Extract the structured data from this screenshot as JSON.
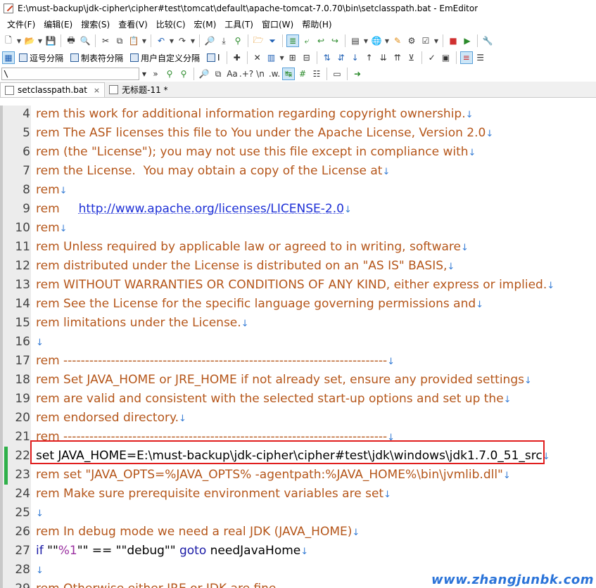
{
  "window": {
    "title": "E:\\must-backup\\jdk-cipher\\cipher#test\\tomcat\\default\\apache-tomcat-7.0.70\\bin\\setclasspath.bat - EmEditor"
  },
  "menu": [
    "文件(F)",
    "编辑(E)",
    "搜索(S)",
    "查看(V)",
    "比较(C)",
    "宏(M)",
    "工具(T)",
    "窗口(W)",
    "帮助(H)"
  ],
  "toolbar2": {
    "items": [
      "逗号分隔",
      "制表符分隔",
      "用户自定义分隔"
    ],
    "tail": "I"
  },
  "search": {
    "value": "\\",
    "regex_labels": [
      ".+?",
      "\\n",
      ".w."
    ]
  },
  "tabs": [
    {
      "label": "setclasspath.bat",
      "active": true,
      "close": "×"
    },
    {
      "label": "无标题-11 *",
      "active": false
    }
  ],
  "lines": [
    {
      "num": "4",
      "text": "rem this work for additional information regarding copyright ownership."
    },
    {
      "num": "5",
      "text": "rem The ASF licenses this file to You under the Apache License, Version 2.0"
    },
    {
      "num": "6",
      "text": "rem (the \"License\"); you may not use this file except in compliance with"
    },
    {
      "num": "7",
      "text": "rem the License.  You may obtain a copy of the License at"
    },
    {
      "num": "8",
      "text": "rem"
    },
    {
      "num": "9",
      "text": "rem     ",
      "link": "http://www.apache.org/licenses/LICENSE-2.0"
    },
    {
      "num": "10",
      "text": "rem"
    },
    {
      "num": "11",
      "text": "rem Unless required by applicable law or agreed to in writing, software"
    },
    {
      "num": "12",
      "text": "rem distributed under the License is distributed on an \"AS IS\" BASIS,"
    },
    {
      "num": "13",
      "text": "rem WITHOUT WARRANTIES OR CONDITIONS OF ANY KIND, either express or implied."
    },
    {
      "num": "14",
      "text": "rem See the License for the specific language governing permissions and"
    },
    {
      "num": "15",
      "text": "rem limitations under the License."
    },
    {
      "num": "16",
      "text": ""
    },
    {
      "num": "17",
      "text": "rem ---------------------------------------------------------------------------"
    },
    {
      "num": "18",
      "text": "rem Set JAVA_HOME or JRE_HOME if not already set, ensure any provided settings"
    },
    {
      "num": "19",
      "text": "rem are valid and consistent with the selected start-up options and set up the"
    },
    {
      "num": "20",
      "text": "rem endorsed directory."
    },
    {
      "num": "21",
      "text": "rem ---------------------------------------------------------------------------"
    },
    {
      "num": "22",
      "text": "set JAVA_HOME=E:\\must-backup\\jdk-cipher\\cipher#test\\jdk\\windows\\jdk1.7.0_51_src",
      "modified": true,
      "plain": true
    },
    {
      "num": "23",
      "text": "rem set \"JAVA_OPTS=%JAVA_OPTS% -agentpath:%JAVA_HOME%\\bin\\jvmlib.dll\"",
      "modified": true
    },
    {
      "num": "24",
      "text": "rem Make sure prerequisite environment variables are set"
    },
    {
      "num": "25",
      "text": ""
    },
    {
      "num": "26",
      "text": "rem In debug mode we need a real JDK (JAVA_HOME)"
    },
    {
      "num": "27",
      "text": "",
      "if_line": {
        "kw1": "if",
        "s1": " \"\"",
        "v1": "%1",
        "s2": "\"\" == \"\"debug\"\" ",
        "kw2": "goto",
        "rest": " needJavaHome"
      }
    },
    {
      "num": "28",
      "text": ""
    },
    {
      "num": "29",
      "text": "rem Otherwise either JRE or JDK are fine",
      "partial": true
    }
  ],
  "eol_mark": "↓",
  "watermark": "www.zhangjunbk.com"
}
